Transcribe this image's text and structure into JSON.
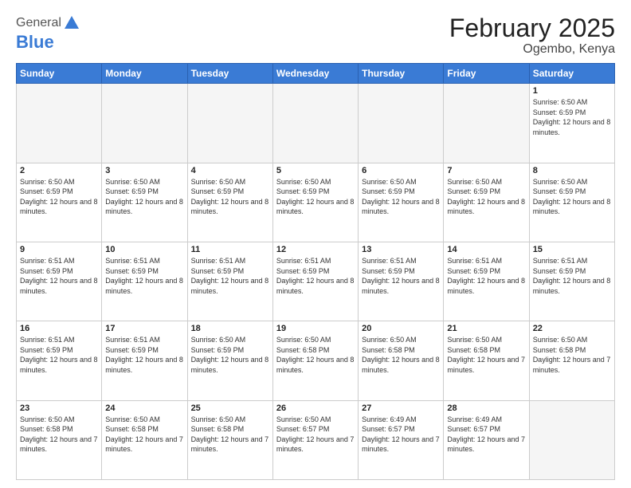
{
  "logo": {
    "general": "General",
    "blue": "Blue"
  },
  "header": {
    "month": "February 2025",
    "location": "Ogembo, Kenya"
  },
  "weekdays": [
    "Sunday",
    "Monday",
    "Tuesday",
    "Wednesday",
    "Thursday",
    "Friday",
    "Saturday"
  ],
  "weeks": [
    [
      {
        "day": "",
        "info": ""
      },
      {
        "day": "",
        "info": ""
      },
      {
        "day": "",
        "info": ""
      },
      {
        "day": "",
        "info": ""
      },
      {
        "day": "",
        "info": ""
      },
      {
        "day": "",
        "info": ""
      },
      {
        "day": "1",
        "info": "Sunrise: 6:50 AM\nSunset: 6:59 PM\nDaylight: 12 hours and 8 minutes."
      }
    ],
    [
      {
        "day": "2",
        "info": "Sunrise: 6:50 AM\nSunset: 6:59 PM\nDaylight: 12 hours and 8 minutes."
      },
      {
        "day": "3",
        "info": "Sunrise: 6:50 AM\nSunset: 6:59 PM\nDaylight: 12 hours and 8 minutes."
      },
      {
        "day": "4",
        "info": "Sunrise: 6:50 AM\nSunset: 6:59 PM\nDaylight: 12 hours and 8 minutes."
      },
      {
        "day": "5",
        "info": "Sunrise: 6:50 AM\nSunset: 6:59 PM\nDaylight: 12 hours and 8 minutes."
      },
      {
        "day": "6",
        "info": "Sunrise: 6:50 AM\nSunset: 6:59 PM\nDaylight: 12 hours and 8 minutes."
      },
      {
        "day": "7",
        "info": "Sunrise: 6:50 AM\nSunset: 6:59 PM\nDaylight: 12 hours and 8 minutes."
      },
      {
        "day": "8",
        "info": "Sunrise: 6:50 AM\nSunset: 6:59 PM\nDaylight: 12 hours and 8 minutes."
      }
    ],
    [
      {
        "day": "9",
        "info": "Sunrise: 6:51 AM\nSunset: 6:59 PM\nDaylight: 12 hours and 8 minutes."
      },
      {
        "day": "10",
        "info": "Sunrise: 6:51 AM\nSunset: 6:59 PM\nDaylight: 12 hours and 8 minutes."
      },
      {
        "day": "11",
        "info": "Sunrise: 6:51 AM\nSunset: 6:59 PM\nDaylight: 12 hours and 8 minutes."
      },
      {
        "day": "12",
        "info": "Sunrise: 6:51 AM\nSunset: 6:59 PM\nDaylight: 12 hours and 8 minutes."
      },
      {
        "day": "13",
        "info": "Sunrise: 6:51 AM\nSunset: 6:59 PM\nDaylight: 12 hours and 8 minutes."
      },
      {
        "day": "14",
        "info": "Sunrise: 6:51 AM\nSunset: 6:59 PM\nDaylight: 12 hours and 8 minutes."
      },
      {
        "day": "15",
        "info": "Sunrise: 6:51 AM\nSunset: 6:59 PM\nDaylight: 12 hours and 8 minutes."
      }
    ],
    [
      {
        "day": "16",
        "info": "Sunrise: 6:51 AM\nSunset: 6:59 PM\nDaylight: 12 hours and 8 minutes."
      },
      {
        "day": "17",
        "info": "Sunrise: 6:51 AM\nSunset: 6:59 PM\nDaylight: 12 hours and 8 minutes."
      },
      {
        "day": "18",
        "info": "Sunrise: 6:50 AM\nSunset: 6:59 PM\nDaylight: 12 hours and 8 minutes."
      },
      {
        "day": "19",
        "info": "Sunrise: 6:50 AM\nSunset: 6:58 PM\nDaylight: 12 hours and 8 minutes."
      },
      {
        "day": "20",
        "info": "Sunrise: 6:50 AM\nSunset: 6:58 PM\nDaylight: 12 hours and 8 minutes."
      },
      {
        "day": "21",
        "info": "Sunrise: 6:50 AM\nSunset: 6:58 PM\nDaylight: 12 hours and 7 minutes."
      },
      {
        "day": "22",
        "info": "Sunrise: 6:50 AM\nSunset: 6:58 PM\nDaylight: 12 hours and 7 minutes."
      }
    ],
    [
      {
        "day": "23",
        "info": "Sunrise: 6:50 AM\nSunset: 6:58 PM\nDaylight: 12 hours and 7 minutes."
      },
      {
        "day": "24",
        "info": "Sunrise: 6:50 AM\nSunset: 6:58 PM\nDaylight: 12 hours and 7 minutes."
      },
      {
        "day": "25",
        "info": "Sunrise: 6:50 AM\nSunset: 6:58 PM\nDaylight: 12 hours and 7 minutes."
      },
      {
        "day": "26",
        "info": "Sunrise: 6:50 AM\nSunset: 6:57 PM\nDaylight: 12 hours and 7 minutes."
      },
      {
        "day": "27",
        "info": "Sunrise: 6:49 AM\nSunset: 6:57 PM\nDaylight: 12 hours and 7 minutes."
      },
      {
        "day": "28",
        "info": "Sunrise: 6:49 AM\nSunset: 6:57 PM\nDaylight: 12 hours and 7 minutes."
      },
      {
        "day": "",
        "info": ""
      }
    ]
  ]
}
